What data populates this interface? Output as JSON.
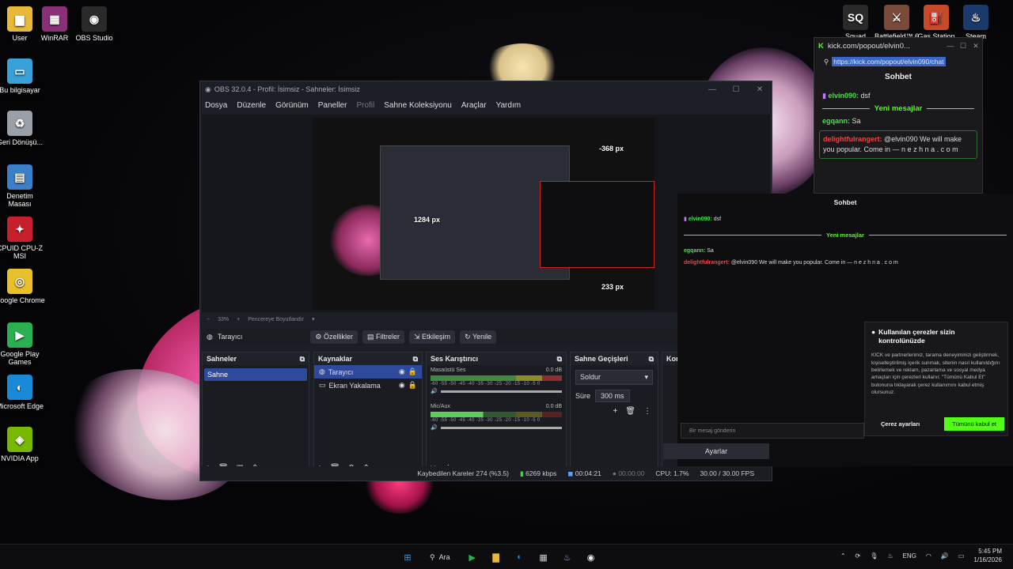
{
  "desktop": {
    "icons_left": [
      {
        "label": "User",
        "icon": "folder-icon",
        "color": "#e8b83a"
      },
      {
        "label": "WinRAR",
        "icon": "winrar-icon",
        "color": "#8a2f7a"
      },
      {
        "label": "OBS Studio",
        "icon": "obs-icon",
        "color": "#2a2a2a"
      },
      {
        "label": "Bu bilgisayar",
        "icon": "computer-icon",
        "color": "#3aa0d8"
      },
      {
        "label": "Geri Dönüşü...",
        "icon": "recycle-bin-icon",
        "color": "#9aa0a8"
      },
      {
        "label": "Denetim Masası",
        "icon": "control-panel-icon",
        "color": "#3a7fc8"
      },
      {
        "label": "CPUID CPU-Z MSI",
        "icon": "cpuz-icon",
        "color": "#c8202a"
      },
      {
        "label": "Google Chrome",
        "icon": "chrome-icon",
        "color": "#e8c02a"
      },
      {
        "label": "Google Play Games",
        "icon": "play-games-icon",
        "color": "#2ab050"
      },
      {
        "label": "Microsoft Edge",
        "icon": "edge-icon",
        "color": "#1a8ad8"
      },
      {
        "label": "NVIDIA App",
        "icon": "nvidia-icon",
        "color": "#76b900"
      }
    ],
    "icons_right": [
      {
        "label": "Squad",
        "icon": "squad-icon",
        "color": "#2a2a2a"
      },
      {
        "label": "Battlefield™ 6",
        "icon": "battlefield-icon",
        "color": "#7a4a3a"
      },
      {
        "label": "Gas Station",
        "icon": "gas-station-icon",
        "color": "#c84a2a"
      },
      {
        "label": "Steam",
        "icon": "steam-icon",
        "color": "#1a3a6a"
      }
    ]
  },
  "obs": {
    "title": "OBS 32.0.4 - Profil: İsimsiz - Sahneler: İsimsiz",
    "menu": [
      "Dosya",
      "Düzenle",
      "Görünüm",
      "Paneller",
      "Profil",
      "Sahne Koleksiyonu",
      "Araçlar",
      "Yardım"
    ],
    "preview_labels": {
      "w1": "1284 px",
      "w2": "-368 px",
      "h": "233 px"
    },
    "zoom": {
      "minus": "−",
      "value": "33%",
      "plus": "+",
      "mode": "Pencereye Boyutlandır"
    },
    "source_toolbar": {
      "source": "Tarayıcı",
      "properties": "Özellikler",
      "filters": "Filtreler",
      "interact": "Etkileşim",
      "refresh": "Yenile"
    },
    "docks": {
      "scenes": {
        "title": "Sahneler",
        "items": [
          "Sahne"
        ]
      },
      "sources": {
        "title": "Kaynaklar",
        "items": [
          "Tarayıcı",
          "Ekran Yakalama"
        ]
      },
      "mixer": {
        "title": "Ses Karıştırıcı",
        "channels": [
          {
            "name": "Masaüstü Ses",
            "db": "0.0 dB"
          },
          {
            "name": "Mic/Aux",
            "db": "0.0 dB"
          }
        ],
        "ticks": "-60 -55 -50 -45 -40 -35 -30 -25 -20 -15 -10 -5 0"
      },
      "transitions": {
        "title": "Sahne Geçişleri",
        "type": "Soldur",
        "duration_label": "Süre",
        "duration": "300 ms"
      },
      "controls": {
        "title": "Kon",
        "settings": "Ayarlar"
      }
    },
    "status": {
      "dropped": "Kaybedilen Kareler 274 (%3.5)",
      "bitrate": "6269 kbps",
      "rec_time": "00:04:21",
      "stream_time": "00:00:00",
      "cpu": "CPU: 1.7%",
      "fps": "30.00 / 30.00 FPS"
    }
  },
  "browser": {
    "tab_title": "kick.com/popout/elvin0...",
    "url": "https://kick.com/popout/elvin090/chat",
    "chat_title": "Sohbet",
    "messages": [
      {
        "user": "elvin090:",
        "text": "dsf"
      },
      {
        "user": "egqann:",
        "text": "Sa"
      },
      {
        "user": "delightfulrangert:",
        "text": "@elvin090 We will make you popular. Come in — n e z h n a . c o m"
      }
    ],
    "new_messages": "Yeni mesajlar"
  },
  "overlay_chat": {
    "title": "Sohbet",
    "line1_user": "elvin090:",
    "line1_text": "dsf",
    "new_messages": "Yeni mesajlar",
    "line2_user": "egqann:",
    "line2_text": "Sa",
    "line3_user": "delightfulrangert:",
    "line3_text": "@elvin090 We will make you popular. Come in — n e z h n a . c o m",
    "input_placeholder": "Bir mesaj gönderin"
  },
  "cookie": {
    "title": "Kullanılan çerezler sizin kontrolünüzde",
    "body": "KICK ve partnerlerimiz, tarama deneyiminizi geliştirmek, kişiselleştirilmiş içerik sunmak, sitenin nasıl kullanıldığını belirlemek ve reklam, pazarlama ve sosyal medya amaçları için çerezleri kullanır. \"Tümünü Kabul Et\" butonuna tıklayarak çerez kullanımını kabul etmiş olursunuz.",
    "settings_btn": "Çerez ayarları",
    "accept_btn": "Tümünü kabul et"
  },
  "taskbar": {
    "search": "Ara",
    "lang": "ENG",
    "time": "5:45 PM",
    "date": "1/16/2026"
  }
}
